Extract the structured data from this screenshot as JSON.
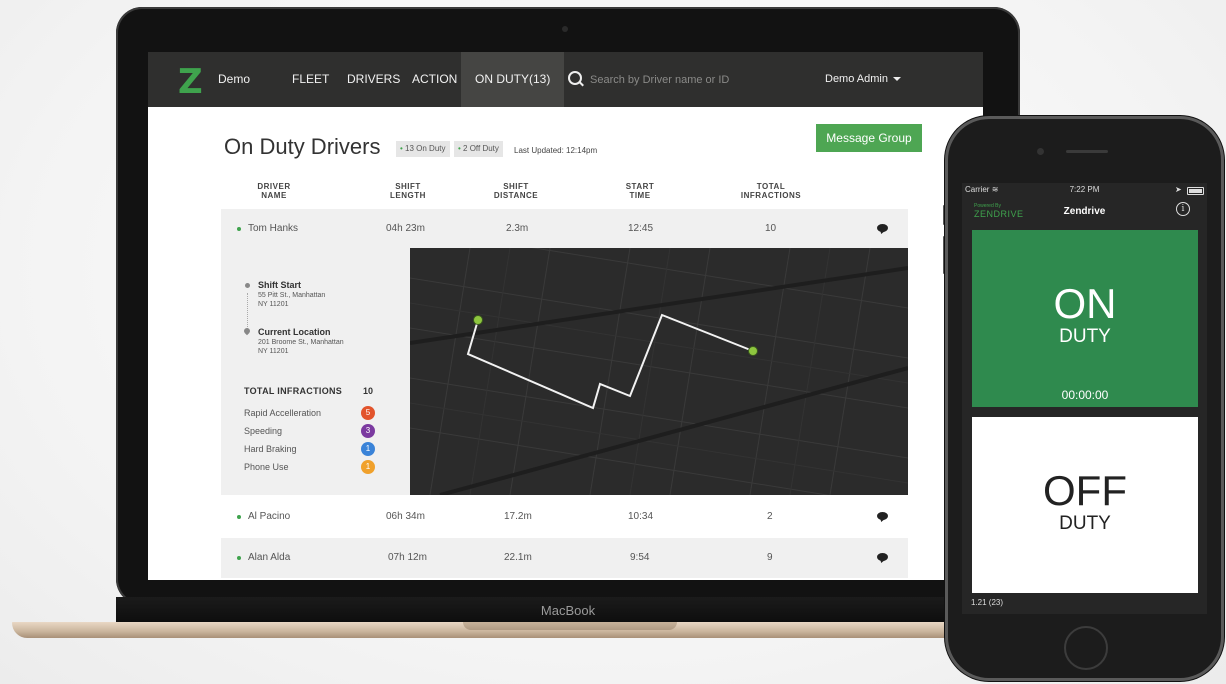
{
  "laptop": {
    "brand": "MacBook"
  },
  "nav": {
    "logo": "Z",
    "app_name": "Demo",
    "items": [
      "FLEET",
      "DRIVERS",
      "ACTION",
      "ON DUTY(13)"
    ],
    "search_placeholder": "Search by Driver name or ID",
    "user": "Demo Admin"
  },
  "page": {
    "title": "On Duty Drivers",
    "on_duty_badge": "13 On Duty",
    "off_duty_badge": "2 Off Duty",
    "last_updated": "Last Updated: 12:14pm",
    "message_button": "Message Group"
  },
  "table": {
    "headers": [
      {
        "line1": "DRIVER",
        "line2": "NAME"
      },
      {
        "line1": "SHIFT",
        "line2": "LENGTH"
      },
      {
        "line1": "SHIFT",
        "line2": "DISTANCE"
      },
      {
        "line1": "START",
        "line2": "TIME"
      },
      {
        "line1": "TOTAL",
        "line2": "INFRACTIONS"
      }
    ],
    "rows": [
      {
        "name": "Tom Hanks",
        "length": "04h 23m",
        "distance": "2.3m",
        "start": "12:45",
        "infractions": "10"
      },
      {
        "name": "Al Pacino",
        "length": "06h 34m",
        "distance": "17.2m",
        "start": "10:34",
        "infractions": "2"
      },
      {
        "name": "Alan Alda",
        "length": "07h 12m",
        "distance": "22.1m",
        "start": "9:54",
        "infractions": "9"
      }
    ]
  },
  "detail": {
    "shift_start_title": "Shift Start",
    "shift_start_line1": "55 Pitt St., Manhattan",
    "shift_start_line2": "NY 11201",
    "current_title": "Current Location",
    "current_line1": "201 Broome St., Manhattan",
    "current_line2": "NY 11201",
    "infractions_title": "TOTAL INFRACTIONS",
    "infractions_total": "10",
    "infractions": [
      {
        "label": "Rapid Accelleration",
        "count": "5",
        "color": "#e2542c"
      },
      {
        "label": "Speeding",
        "count": "3",
        "color": "#7b3aa0"
      },
      {
        "label": "Hard Braking",
        "count": "1",
        "color": "#3a83d8"
      },
      {
        "label": "Phone Use",
        "count": "1",
        "color": "#f0a12c"
      }
    ]
  },
  "phone": {
    "carrier": "Carrier",
    "time": "7:22 PM",
    "powered_by": "Powered By",
    "brand_logo": "ZENDRIVE",
    "app_title": "Zendrive",
    "info": "i",
    "on_label": "ON",
    "on_sub": "DUTY",
    "timer": "00:00:00",
    "off_label": "OFF",
    "off_sub": "DUTY",
    "version": "1.21 (23)"
  },
  "colors": {
    "accent_green": "#3fa34d",
    "on_duty_bg": "#2f8a4e",
    "nav_bg": "#2f2f2e"
  }
}
